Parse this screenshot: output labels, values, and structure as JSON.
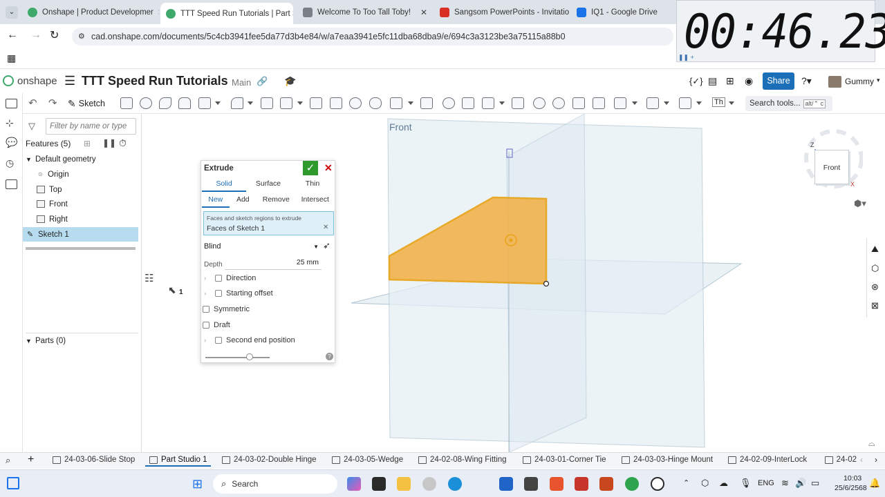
{
  "browser": {
    "tabs": [
      {
        "label": "Onshape | Product Developmer",
        "color": "#3fa96b"
      },
      {
        "label": "TTT Speed Run Tutorials | Part S",
        "color": "#3fa96b",
        "active": true
      },
      {
        "label": "Welcome To Too Tall Toby!",
        "color": "#7a7f86"
      },
      {
        "label": "Sangsom PowerPoints - Invitatio",
        "color": "#d93025"
      },
      {
        "label": "IQ1 - Google Drive",
        "color": "#1a73e8"
      }
    ],
    "url": "cad.onshape.com/documents/5c4cb3941fee5da77d3b4e84/w/a7eaa3941e5fc11dba68dba9/e/694c3a3123be3a75115a88b0"
  },
  "timer": {
    "value": "00:46.23"
  },
  "header": {
    "logo": "onshape",
    "doc_title": "TTT Speed Run Tutorials",
    "branch": "Main",
    "share_label": "Share",
    "user": "Gummy"
  },
  "toolbar": {
    "sketch_label": "Sketch",
    "search_label": "Search tools...",
    "search_shortcut": "alt/⌃ c",
    "th_label": "Th"
  },
  "features": {
    "filter_placeholder": "Filter by name or type",
    "heading": "Features (5)",
    "default_geometry": "Default geometry",
    "items": [
      "Origin",
      "Top",
      "Front",
      "Right"
    ],
    "selected": "Sketch 1",
    "parts": "Parts (0)"
  },
  "extrude": {
    "title": "Extrude",
    "type_tabs": [
      "Solid",
      "Surface",
      "Thin"
    ],
    "op_tabs": [
      "New",
      "Add",
      "Remove",
      "Intersect"
    ],
    "faces_label": "Faces and sketch regions to extrude",
    "faces_value": "Faces of Sketch 1",
    "end_type": "Blind",
    "depth_label": "Depth",
    "depth_value": "25 mm",
    "options": {
      "direction": "Direction",
      "starting_offset": "Starting offset",
      "symmetric": "Symmetric",
      "draft": "Draft",
      "second_end": "Second end position"
    }
  },
  "viewport": {
    "plane_label": "Front",
    "viewcube_label": "Front",
    "axis_z": "Z",
    "axis_x": "X",
    "cursor_badge": "1"
  },
  "bottom_tabs": [
    "24-03-06-Slide Stop",
    "Part Studio 1",
    "24-03-02-Double Hinge",
    "24-03-05-Wedge",
    "24-02-08-Wing Fitting",
    "24-03-01-Corner Tie",
    "24-03-03-Hinge Mount",
    "24-02-09-InterLock",
    "24-02"
  ],
  "taskbar": {
    "search": "Search",
    "lang": "ENG",
    "time": "10:03",
    "date": "25/6/2568"
  }
}
